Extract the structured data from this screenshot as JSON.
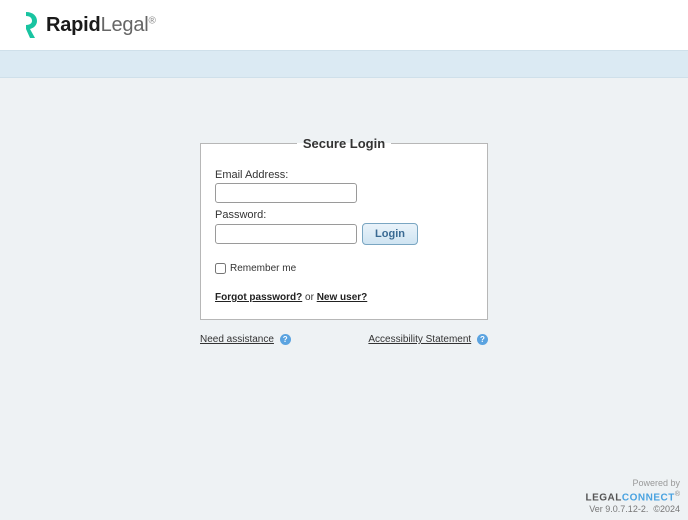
{
  "brand": {
    "name_bold": "Rapid",
    "name_light": "Legal",
    "registered": "®"
  },
  "login": {
    "legend": "Secure Login",
    "email_label": "Email Address:",
    "password_label": "Password:",
    "login_button": "Login",
    "remember_label": "Remember me",
    "forgot_link": "Forgot password?",
    "or_text": " or ",
    "newuser_link": "New user?"
  },
  "below": {
    "need_assist": "Need assistance",
    "accessibility": "Accessibility Statement"
  },
  "footer": {
    "powered": "Powered by",
    "legal_l": "LEGAL",
    "legal_c": "CONNECT",
    "registered": "®",
    "version": "Ver 9.0.7.12-2.",
    "copyright": "©2024"
  }
}
